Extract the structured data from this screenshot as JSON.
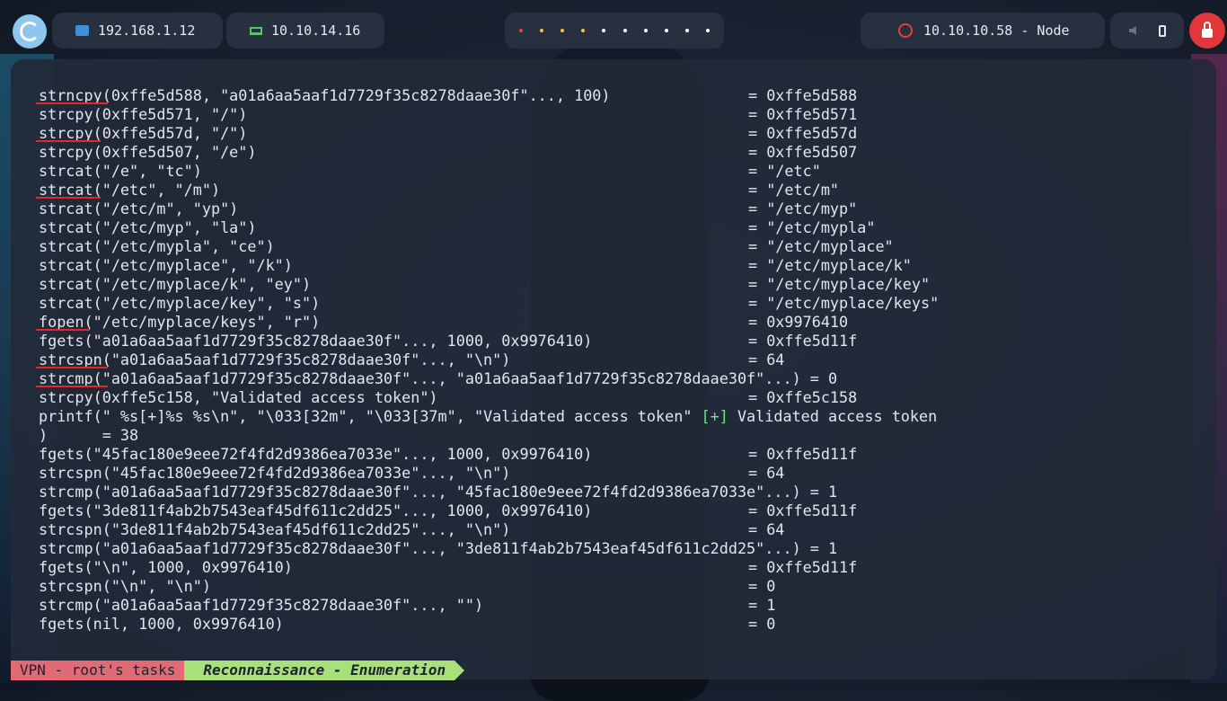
{
  "topbar": {
    "local_ip": "192.168.1.12",
    "vpn_ip": "10.10.14.16",
    "target": "10.10.10.58 - Node",
    "workspace_colors": [
      "#e8403c",
      "#f4c046",
      "#f4c046",
      "#f4c046",
      "#ffffff",
      "#ffffff",
      "#ffffff",
      "#ffffff",
      "#ffffff",
      "#ffffff"
    ]
  },
  "terminal": {
    "lines": [
      {
        "call": "strncpy(0xffe5d588, \"a01a6aa5aaf1d7729f35c8278daae30f\"..., 100)",
        "ret": "= 0xffe5d588"
      },
      {
        "call": "strcpy(0xffe5d571, \"/\")",
        "ret": "= 0xffe5d571"
      },
      {
        "call": "strcpy(0xffe5d57d, \"/\")",
        "ret": "= 0xffe5d57d"
      },
      {
        "call": "strcpy(0xffe5d507, \"/e\")",
        "ret": "= 0xffe5d507"
      },
      {
        "call": "strcat(\"/e\", \"tc\")",
        "ret": "= \"/etc\""
      },
      {
        "call": "strcat(\"/etc\", \"/m\")",
        "ret": "= \"/etc/m\""
      },
      {
        "call": "strcat(\"/etc/m\", \"yp\")",
        "ret": "= \"/etc/myp\""
      },
      {
        "call": "strcat(\"/etc/myp\", \"la\")",
        "ret": "= \"/etc/mypla\""
      },
      {
        "call": "strcat(\"/etc/mypla\", \"ce\")",
        "ret": "= \"/etc/myplace\""
      },
      {
        "call": "strcat(\"/etc/myplace\", \"/k\")",
        "ret": "= \"/etc/myplace/k\""
      },
      {
        "call": "strcat(\"/etc/myplace/k\", \"ey\")",
        "ret": "= \"/etc/myplace/key\""
      },
      {
        "call": "strcat(\"/etc/myplace/key\", \"s\")",
        "ret": "= \"/etc/myplace/keys\""
      },
      {
        "call": "fopen(\"/etc/myplace/keys\", \"r\")",
        "ret": "= 0x9976410"
      },
      {
        "call": "fgets(\"a01a6aa5aaf1d7729f35c8278daae30f\"..., 1000, 0x9976410)",
        "ret": "= 0xffe5d11f"
      },
      {
        "call": "strcspn(\"a01a6aa5aaf1d7729f35c8278daae30f\"..., \"\\n\")",
        "ret": "= 64"
      },
      {
        "call": "strcmp(\"a01a6aa5aaf1d7729f35c8278daae30f\"..., \"a01a6aa5aaf1d7729f35c8278daae30f\"...) = 0",
        "ret": ""
      },
      {
        "call": "strcpy(0xffe5c158, \"Validated access token\")",
        "ret": "= 0xffe5c158"
      },
      {
        "call": "printf(\" %s[+]%s %s\\n\", \"\\033[32m\", \"\\033[37m\", \"Validated access token\" ",
        "green": "[+]",
        "tail": " Validated access token"
      },
      {
        "call": ")      = 38",
        "ret": ""
      },
      {
        "call": "fgets(\"45fac180e9eee72f4fd2d9386ea7033e\"..., 1000, 0x9976410)",
        "ret": "= 0xffe5d11f"
      },
      {
        "call": "strcspn(\"45fac180e9eee72f4fd2d9386ea7033e\"..., \"\\n\")",
        "ret": "= 64"
      },
      {
        "call": "strcmp(\"a01a6aa5aaf1d7729f35c8278daae30f\"..., \"45fac180e9eee72f4fd2d9386ea7033e\"...) = 1",
        "ret": ""
      },
      {
        "call": "fgets(\"3de811f4ab2b7543eaf45df611c2dd25\"..., 1000, 0x9976410)",
        "ret": "= 0xffe5d11f"
      },
      {
        "call": "strcspn(\"3de811f4ab2b7543eaf45df611c2dd25\"..., \"\\n\")",
        "ret": "= 64"
      },
      {
        "call": "strcmp(\"a01a6aa5aaf1d7729f35c8278daae30f\"..., \"3de811f4ab2b7543eaf45df611c2dd25\"...) = 1",
        "ret": ""
      },
      {
        "call": "fgets(\"\\n\", 1000, 0x9976410)",
        "ret": "= 0xffe5d11f"
      },
      {
        "call": "strcspn(\"\\n\", \"\\n\")",
        "ret": "= 0"
      },
      {
        "call": "strcmp(\"a01a6aa5aaf1d7729f35c8278daae30f\"..., \"\")",
        "ret": "= 1"
      },
      {
        "call": "fgets(nil, 1000, 0x9976410)",
        "ret": "= 0"
      }
    ]
  },
  "statusbar": {
    "session": "VPN - root's tasks",
    "window": "Reconnaissance - Enumeration"
  },
  "accent_colors": {
    "underline": "#e02929",
    "logo": "#8fc6ee",
    "lock": "#e0373a",
    "status_session": "#e26a75",
    "status_window": "#a8e07a"
  }
}
